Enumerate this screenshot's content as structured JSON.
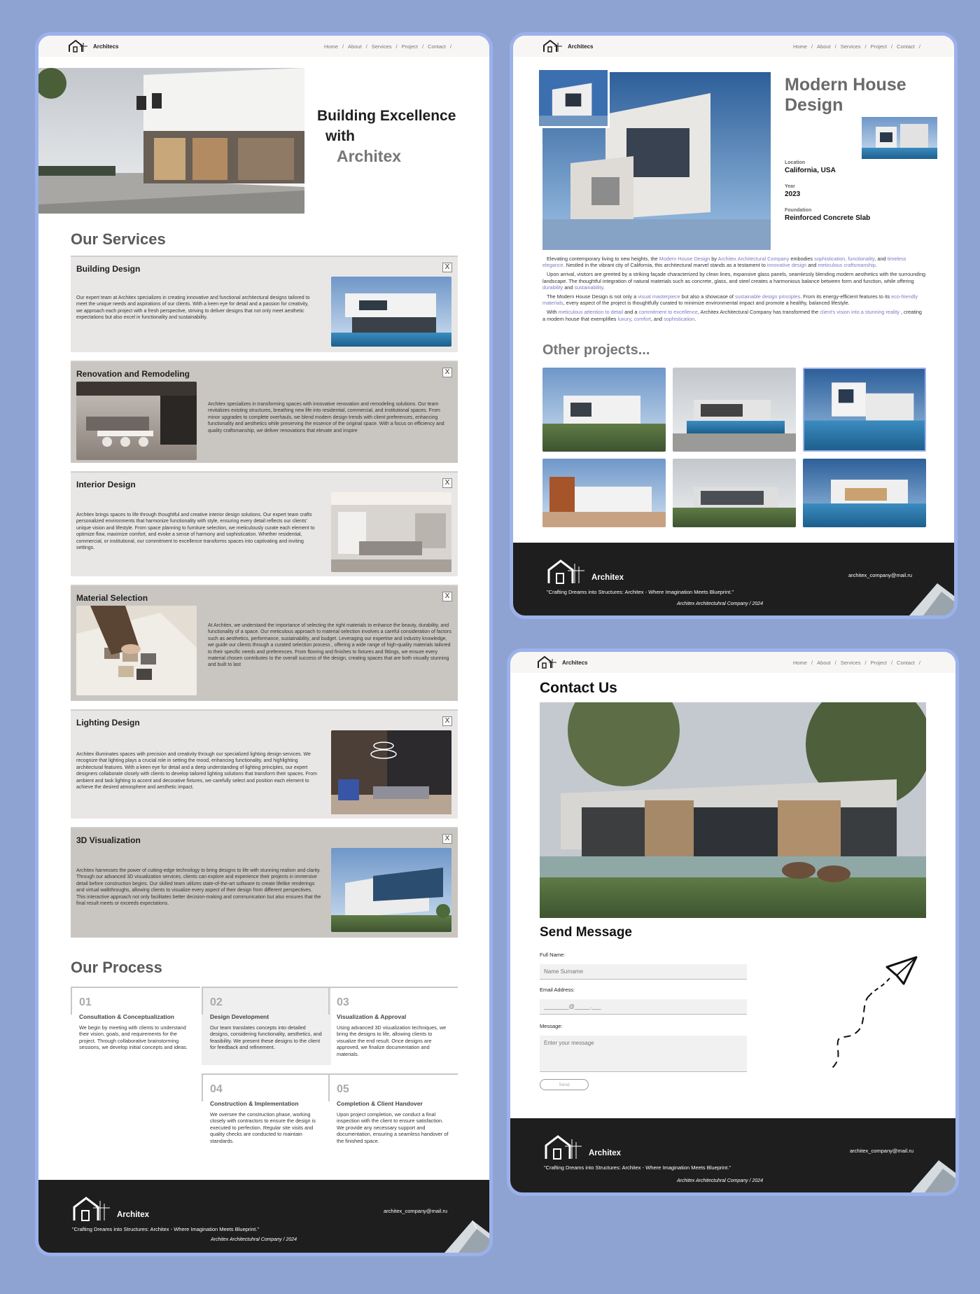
{
  "nav": {
    "brand_short": "Architecs",
    "items": [
      "Home",
      "/",
      "About",
      "/",
      "Services",
      "/",
      "Project",
      "/",
      "Contact",
      "/"
    ]
  },
  "home": {
    "hero": {
      "line1": "Building Excellence",
      "line2": "with",
      "line3": "Architex"
    },
    "services_title": "Our Services",
    "services": [
      {
        "title": "Building Design",
        "text": "Our expert team at Architex specializes in creating innovative and functional architectural designs tailored to meet the unique needs and aspirations of our clients. With a keen eye for detail and a passion for creativity, we approach each project with a fresh perspective, striving to deliver designs that not only meet aesthetic expectations but also excel in functionality and sustainability."
      },
      {
        "title": "Renovation and Remodeling",
        "text": "Architex specializes in transforming spaces with innovative renovation and remodeling solutions. Our team revitalizes existing structures, breathing new life into residential, commercial, and institutional spaces. From minor upgrades to complete overhauls, we blend modern design trends with client preferences, enhancing functionality and aesthetics while preserving the essence of the original space. With a focus on efficiency and quality craftsmanship, we deliver renovations that elevate and inspire"
      },
      {
        "title": "Interior Design",
        "text": "Architex brings spaces to life through thoughtful and creative interior design solutions. Our expert team crafts personalized environments that harmonize functionality with style, ensuring every detail reflects our clients' unique vision and lifestyle. From space planning to furniture selection, we meticulously curate each element to optimize flow, maximize comfort, and evoke a sense of harmony and sophistication. Whether residential, commercial, or institutional, our commitment to excellence transforms spaces into captivating and inviting settings."
      },
      {
        "title": "Material Selection",
        "text": "At Architex, we understand the importance of selecting the right materials to enhance the beauty, durability, and functionality of a space. Our meticulous approach to material selection involves a careful consideration of factors such as aesthetics, performance, sustainability, and budget. Leveraging our expertise and industry knowledge, we guide our clients through a curated selection process , offering a wide range of high-quality materials tailored to their specific needs and preferences. From flooring and finishes to fixtures and fittings, we ensure every material chosen contributes to the overall success of the design, creating spaces that are both visually stunning and built to last"
      },
      {
        "title": "Lighting Design",
        "text": "Architex illuminates spaces with precision and creativity through our specialized lighting design services. We recognize that lighting plays a crucial role in setting the mood, enhancing functionality, and highlighting architectural features. With a keen eye for detail and a deep understanding of lighting principles, our expert designers collaborate closely with clients to develop tailored lighting solutions that transform their spaces. From ambient and task lighting to accent and decorative fixtures, we carefully select and position each element to achieve the desired atmosphere and aesthetic impact."
      },
      {
        "title": "3D Visualization",
        "text": "Architex harnesses the power of cutting-edge technology to bring designs to life with stunning realism and clarity. Through our advanced 3D visualization services, clients can explore and experience their projects in immersive detail before construction begins. Our skilled team utilizes state-of-the-art software to create lifelike renderings and virtual walkthroughs, allowing clients to visualize every aspect of their design from different perspectives. This interactive approach not only facilitates better decision-making and communication but also ensures that the final result meets or exceeds expectations."
      }
    ],
    "close_glyph": "X",
    "process_title": "Our Process",
    "process": [
      {
        "num": "01",
        "title": "Consultation & Conceptualization",
        "text": "We begin by meeting with clients to understand their vision, goals, and requirements for the project. Through collaborative brainstorming sessions, we develop initial concepts and ideas."
      },
      {
        "num": "02",
        "title": "Design Development",
        "text": "Our team translates concepts into detailed designs, considering functionality, aesthetics, and feasibility. We present these designs to the client for feedback and refinement."
      },
      {
        "num": "03",
        "title": "Visualization & Approval",
        "text": "Using advanced 3D visualization techniques, we bring the designs to life, allowing clients to visualize the end result. Once designs are approved, we finalize documentation and materials."
      },
      {
        "num": "04",
        "title": "Construction & Implementation",
        "text": "We oversee the construction phase, working closely with contractors to ensure the design is executed to perfection. Regular site visits and quality checks are conducted to maintain standards."
      },
      {
        "num": "05",
        "title": "Completion & Client Handover",
        "text": "Upon project completion, we conduct a final inspection with the client to ensure satisfaction. We provide any necessary support and documentation, ensuring a seamless handover of the finished space."
      }
    ]
  },
  "project": {
    "title_line1": "Modern House",
    "title_line2": "Design",
    "location_label": "Location",
    "location": "California, USA",
    "year_label": "Year",
    "year": "2023",
    "foundation_label": "Foundation",
    "foundation": "Reinforced Concrete Slab",
    "p1": {
      "a": "Elevating contemporary living to new heights, the ",
      "b": "Modern House Design",
      "c": " by ",
      "d": "Architex Architectural Company",
      "e": " embodies ",
      "f": "sophistication, functionality,",
      "g": " and ",
      "h": "timeless elegance",
      "i": ". Nestled in the vibrant city of California, this architectural marvel stands as a testament to ",
      "j": "innovative design",
      "k": " and ",
      "l": "meticulous craftsmanship",
      "m": "."
    },
    "p2": {
      "a": "Upon arrival, visitors are greeted by a striking façade characterized by clean lines, expansive glass panels, seamlessly blending modern aesthetics with the surrounding landscape. The thoughtful integration of natural materials such as concrete, glass, and steel creates a harmonious balance between form and function, while offering ",
      "b": "durability",
      "c": " and ",
      "d": "sustainability",
      "e": "."
    },
    "p3": {
      "a": "The Modern House Design is not only a ",
      "b": "visual masterpiece",
      "c": " but also a showcase of ",
      "d": "sustainable design principles",
      "e": ". From its energy-efficient features to its ",
      "f": "eco-friendly materials",
      "g": ", every aspect of the project is thoughtfully curated to minimize environmental impact and promote a healthy, balanced lifestyle."
    },
    "p4": {
      "a": "With ",
      "b": "meticulous attention to detail",
      "c": " and a ",
      "d": "commitment to excellence",
      "e": ", Architex Architectural Company has transformed the ",
      "f": "client's vision into a stunning reality",
      "g": " , creating a modern house that exemplifies ",
      "h": "luxury",
      "i": ", ",
      "j": "comfort",
      "k": ", and ",
      "l": "sophistication",
      "m": "."
    },
    "other_title": "Other projects..."
  },
  "contact": {
    "title": "Contact Us",
    "send_title": "Send Message",
    "name_label": "Full Name:",
    "name_placeholder": "Name Surname",
    "email_label": "Email Address:",
    "email_placeholder": "________@_____.___",
    "message_label": "Message:",
    "message_placeholder": "Enter your message",
    "send_label": "Send"
  },
  "footer": {
    "brand": "Architex",
    "quote": "\"Crafting Dreams into Structures: Architex - Where Imagination Meets Blueprint.\"",
    "company": "Architex Architectuhral Company / 2024",
    "email": "architex_company@mail.ru"
  },
  "colors": {
    "page_bg": "#8ea3d2",
    "frame_border": "#9bb1ea",
    "footer_bg": "#1f1e1f",
    "highlight": "#7a7ac2",
    "card_light": "#e9e7e6",
    "card_dark": "#c9c6c2"
  },
  "icons": [
    "house-logo-icon",
    "close-x-icon",
    "paper-plane-icon"
  ]
}
